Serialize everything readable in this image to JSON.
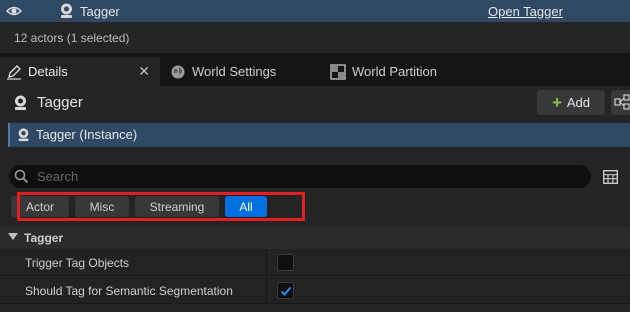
{
  "outliner": {
    "actor_name": "Tagger",
    "open_link": "Open Tagger",
    "status": "12 actors (1 selected)"
  },
  "tabs": [
    {
      "label": "Details",
      "icon": "details-pencil-icon",
      "active": true
    },
    {
      "label": "World Settings",
      "icon": "globe-icon",
      "active": false
    },
    {
      "label": "World Partition",
      "icon": "grid-map-icon",
      "active": false
    }
  ],
  "details": {
    "title": "Tagger",
    "add_label": "Add",
    "component": "Tagger (Instance)",
    "search_placeholder": "Search",
    "filters": [
      "Actor",
      "Misc",
      "Streaming",
      "All"
    ],
    "active_filter": "All",
    "category": "Tagger",
    "properties": [
      {
        "label": "Trigger Tag Objects",
        "checked": false
      },
      {
        "label": "Should Tag for Semantic Segmentation",
        "checked": true
      }
    ]
  },
  "colors": {
    "selection": "#2f4965",
    "accent": "#0070e0",
    "highlight": "#e31e24",
    "add_green": "#8bc34a"
  }
}
